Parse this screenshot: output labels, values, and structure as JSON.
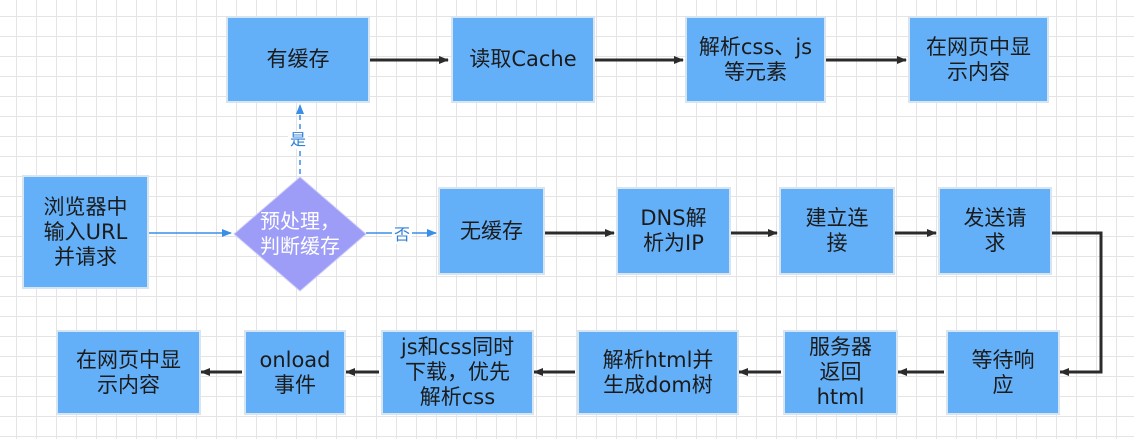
{
  "nodes": {
    "browser_input": "浏览器中\n输入URL\n并请求",
    "decision": "预处理，\n判断缓存",
    "has_cache": "有缓存",
    "read_cache": "读取Cache",
    "parse_css_js": "解析css、js\n等元素",
    "display_top": "在网页中显\n示内容",
    "no_cache": "无缓存",
    "dns": "DNS解\n析为IP",
    "connect": "建立连\n接",
    "send_request": "发送请\n求",
    "wait_response": "等待响\n应",
    "server_return": "服务器\n返回\nhtml",
    "parse_html": "解析html并\n生成dom树",
    "download_parse": "js和css同时\n下载，优先\n解析css",
    "onload": "onload\n事件",
    "display_bottom": "在网页中显\n示内容"
  },
  "edge_labels": {
    "yes": "是",
    "no": "否"
  },
  "colors": {
    "box_fill": "#64b0f8",
    "diamond_fill": "#9d9cf7",
    "arrow_dark": "#2b2b2b",
    "arrow_blue": "#3a8ee6"
  }
}
